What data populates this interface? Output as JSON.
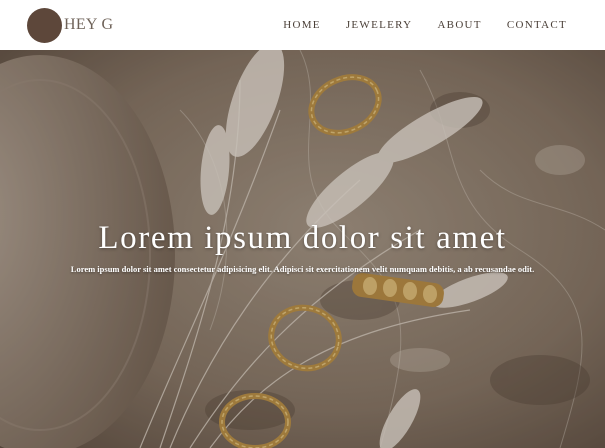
{
  "nav": {
    "brand": "HEY G",
    "links": [
      "HOME",
      "JEWELERY",
      "ABOUT",
      "CONTACT"
    ]
  },
  "hero": {
    "title": "Lorem ipsum dolor sit amet",
    "subtitle": "Lorem ipsum dolor sit amet consectetur adipisicing elit. Adipisci sit exercitationem velit numquam debitis, a ab recusandae odit."
  },
  "colors": {
    "logo": "#5d473a",
    "nav_text": "#4a3f37",
    "background": "#ffffff"
  }
}
